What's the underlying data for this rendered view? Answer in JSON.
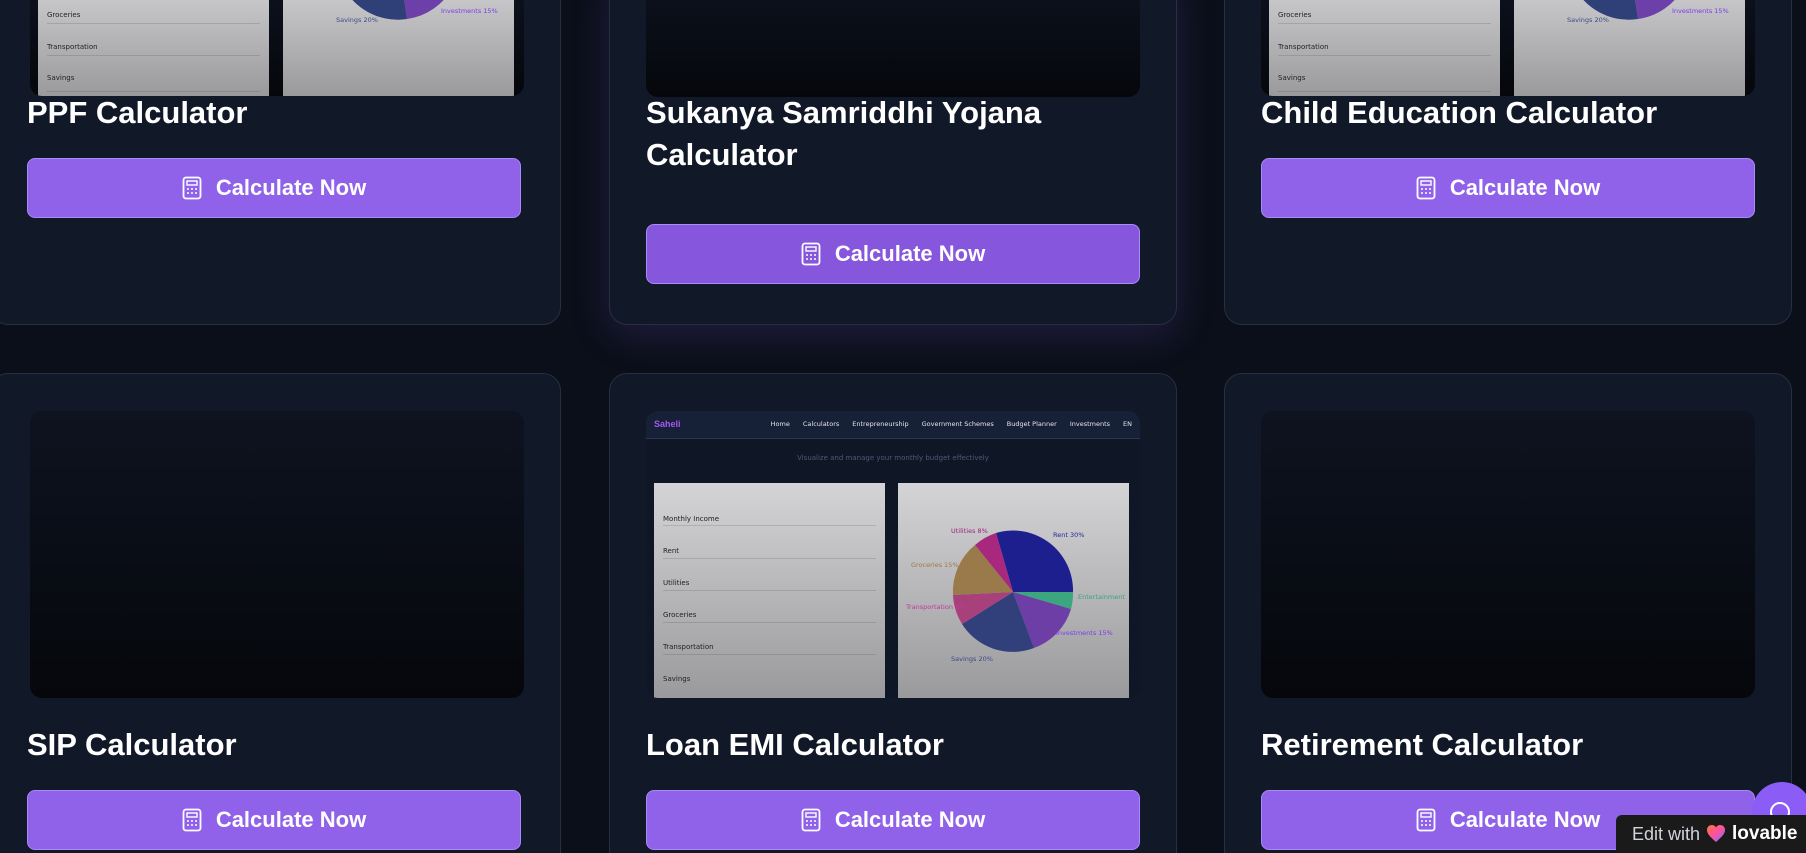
{
  "cards": [
    {
      "title": "PPF Calculator",
      "button": "Calculate Now"
    },
    {
      "title": "Sukanya Samriddhi Yojana Calculator",
      "button": "Calculate Now"
    },
    {
      "title": "Child Education Calculator",
      "button": "Calculate Now"
    },
    {
      "title": "SIP Calculator",
      "button": "Calculate Now"
    },
    {
      "title": "Loan EMI Calculator",
      "button": "Calculate Now"
    },
    {
      "title": "Retirement Calculator",
      "button": "Calculate Now"
    }
  ],
  "preview": {
    "brand": "Saheli",
    "nav": [
      "Home",
      "Calculators",
      "Entrepreneurship",
      "Government Schemes",
      "Budget Planner",
      "Investments",
      "EN"
    ],
    "subtitle": "Visualize and manage your monthly budget effectively",
    "form_rows": [
      "Monthly Income",
      "Rent",
      "Utilities",
      "Groceries",
      "Transportation",
      "Savings"
    ],
    "top_rows": [
      "Groceries",
      "Transportation",
      "Savings"
    ],
    "pie_labels": {
      "rent": "Rent 30%",
      "utilities": "Utilities 8%",
      "groceries": "Groceries 15%",
      "transportation": "Transportation 8%",
      "savings": "Savings 20%",
      "investments": "Investments 15%",
      "entertainment": "Entertainment"
    }
  },
  "badge": {
    "prefix": "Edit with",
    "brand": "lovable"
  },
  "colors": {
    "accent": "#9061e9",
    "background": "#0b0f19",
    "card": "#111827"
  }
}
